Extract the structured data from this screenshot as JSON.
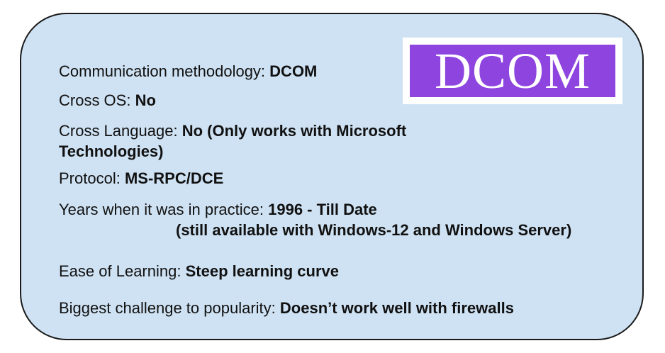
{
  "logo": {
    "text": "DCOM",
    "colors": {
      "background": "#8e44de",
      "text": "#ffffff",
      "frame": "#ffffff"
    }
  },
  "card": {
    "background": "#cfe2f3",
    "border": "#1a1a1a"
  },
  "rows": [
    {
      "label": "Communication methodology:",
      "value": "DCOM"
    },
    {
      "label": "Cross OS:",
      "value": "No"
    },
    {
      "label": "Cross Language:",
      "value": "No (Only works with Microsoft",
      "value_line2": "Technologies)"
    },
    {
      "label": "Protocol:",
      "value": "MS-RPC/DCE"
    },
    {
      "label": "Years when it was in practice:",
      "value": "1996 - Till Date",
      "value_line2": "(still available with Windows-12 and Windows Server)"
    },
    {
      "label": "Ease of Learning:",
      "value": "Steep learning curve"
    },
    {
      "label": "Biggest challenge to popularity:",
      "value": "Doesn’t work well with firewalls"
    }
  ]
}
